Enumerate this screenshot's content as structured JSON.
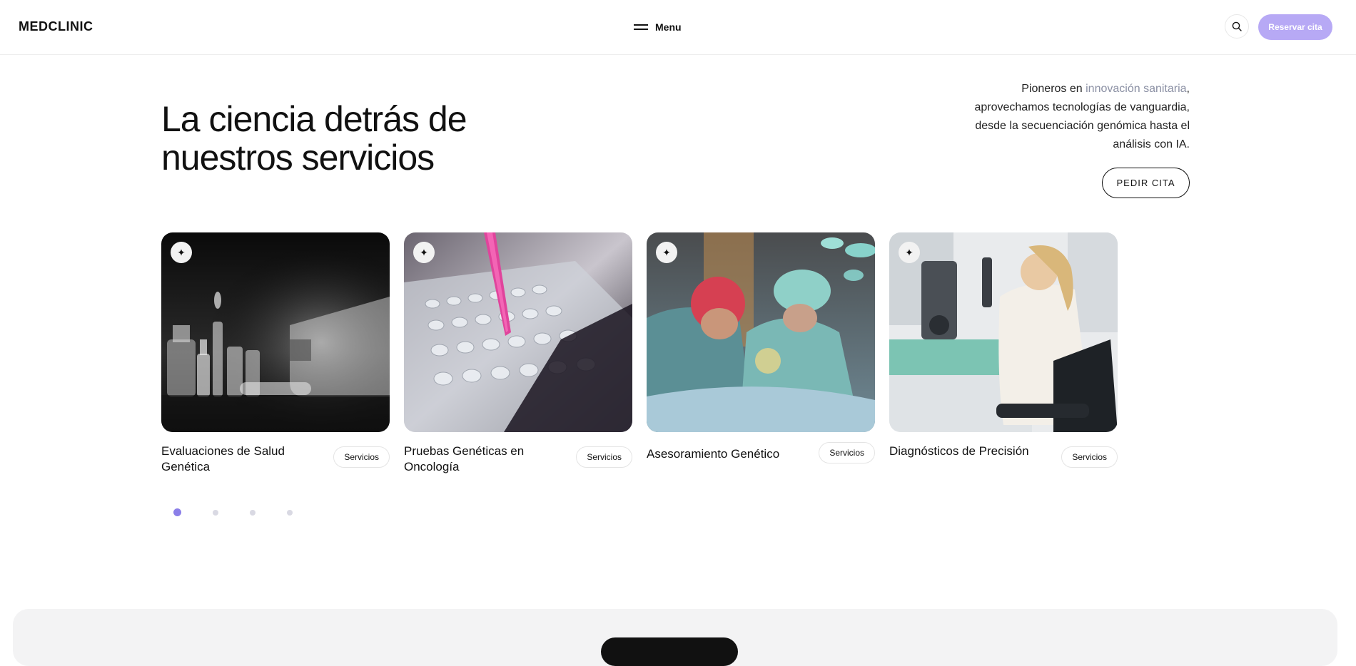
{
  "header": {
    "logo": "MEDCLINIC",
    "menu_label": "Menu",
    "reserve_label": "Reservar cita"
  },
  "hero": {
    "title_line1": "La ciencia detrás de",
    "title_line2": "nuestros servicios",
    "intro_before": "Pioneros en ",
    "intro_highlight": "innovación sanitaria",
    "intro_after": ", aprovechamos tecnologías de vanguardia, desde la secuenciación genómica hasta el análisis con IA.",
    "cta_label": "PEDIR CITA"
  },
  "cards": [
    {
      "title": "Evaluaciones de Salud Genética",
      "tag": "Servicios",
      "icon": "sparkle-icon"
    },
    {
      "title": "Pruebas Genéticas en Oncología",
      "tag": "Servicios",
      "icon": "sparkle-icon"
    },
    {
      "title": "Asesoramiento Genético",
      "tag": "Servicios",
      "icon": "sparkle-icon"
    },
    {
      "title": "Diagnósticos de Precisión",
      "tag": "Servicios",
      "icon": "sparkle-icon"
    }
  ],
  "carousel": {
    "active_index": 0,
    "count": 4
  },
  "colors": {
    "accent": "#8b7fe8",
    "reserve_bg": "#b7a9f5",
    "highlight_text": "#8a8fa3"
  }
}
